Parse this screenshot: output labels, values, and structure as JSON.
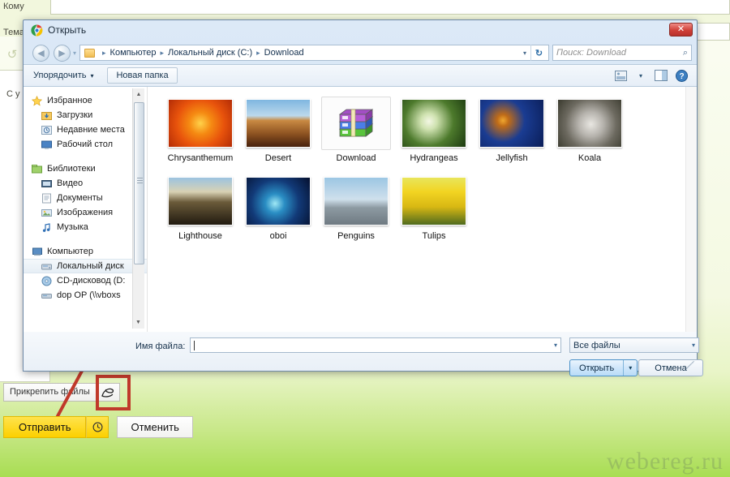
{
  "background": {
    "to_label": "Кому",
    "subject_label": "Тема",
    "body_hint": "С у",
    "undo_icon": "undo-arrow-icon",
    "attach_button": "Прикрепить файлы",
    "attach_icon": "paperclip-icon",
    "send_button": "Отправить",
    "send_clock_icon": "clock-icon",
    "cancel_button": "Отменить",
    "watermark": "webereg.ru",
    "highlight_color": "#c0392b"
  },
  "dialog": {
    "title": "Открыть",
    "title_icon": "chrome-icon",
    "close_label": "✕",
    "nav": {
      "back_icon": "back-arrow-icon",
      "forward_icon": "forward-arrow-icon",
      "dropdown_icon": "chevron-down-icon",
      "folder_icon": "folder-icon",
      "breadcrumbs": [
        "Компьютер",
        "Локальный диск (C:)",
        "Download"
      ],
      "separator": "▸",
      "refresh_icon": "refresh-icon",
      "search_placeholder": "Поиск: Download",
      "search_icon": "magnifier-icon"
    },
    "toolbar": {
      "organize_label": "Упорядочить",
      "organize_caret": "▾",
      "new_folder_label": "Новая папка",
      "view_icon": "view-mode-icon",
      "view_caret": "▾",
      "preview_pane_icon": "preview-pane-icon",
      "help_icon": "help-icon"
    },
    "sidebar": {
      "groups": [
        {
          "label": "Избранное",
          "icon": "star-icon",
          "items": [
            {
              "label": "Загрузки",
              "icon": "downloads-icon"
            },
            {
              "label": "Недавние места",
              "icon": "recent-places-icon"
            },
            {
              "label": "Рабочий стол",
              "icon": "desktop-icon"
            }
          ]
        },
        {
          "label": "Библиотеки",
          "icon": "libraries-icon",
          "items": [
            {
              "label": "Видео",
              "icon": "video-icon"
            },
            {
              "label": "Документы",
              "icon": "documents-icon"
            },
            {
              "label": "Изображения",
              "icon": "pictures-icon"
            },
            {
              "label": "Музыка",
              "icon": "music-icon"
            }
          ]
        },
        {
          "label": "Компьютер",
          "icon": "computer-icon",
          "items": [
            {
              "label": "Локальный диск",
              "icon": "hdd-icon",
              "selected": true
            },
            {
              "label": "CD-дисковод (D:",
              "icon": "cd-drive-icon"
            },
            {
              "label": "dop OP (\\\\vboxs",
              "icon": "network-drive-icon"
            }
          ]
        }
      ]
    },
    "files": [
      {
        "name": "Chrysanthemum",
        "type": "image",
        "selected": false
      },
      {
        "name": "Desert",
        "type": "image",
        "selected": false
      },
      {
        "name": "Download",
        "type": "archive",
        "selected": true
      },
      {
        "name": "Hydrangeas",
        "type": "image",
        "selected": false
      },
      {
        "name": "Jellyfish",
        "type": "image",
        "selected": false
      },
      {
        "name": "Koala",
        "type": "image",
        "selected": false
      },
      {
        "name": "Lighthouse",
        "type": "image",
        "selected": false
      },
      {
        "name": "oboi",
        "type": "image",
        "selected": false
      },
      {
        "name": "Penguins",
        "type": "image",
        "selected": false
      },
      {
        "name": "Tulips",
        "type": "image",
        "selected": false
      }
    ],
    "footer": {
      "filename_label": "Имя файла:",
      "filename_value": "",
      "filename_caret": "▾",
      "filter_value": "Все файлы",
      "filter_caret": "▾",
      "open_label": "Открыть",
      "open_caret": "▾",
      "cancel_label": "Отмена"
    }
  }
}
